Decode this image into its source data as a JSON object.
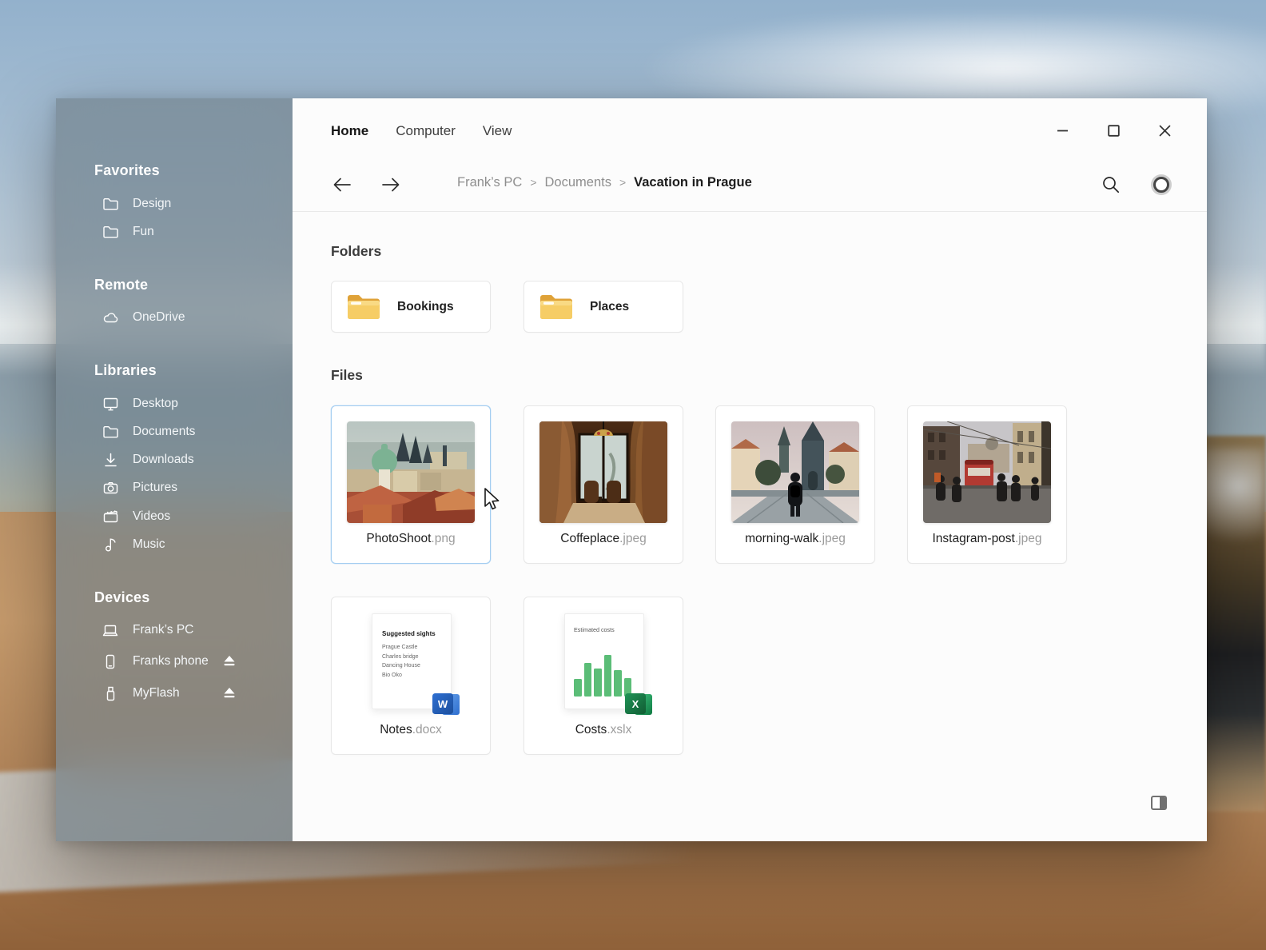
{
  "window": {
    "tabs": [
      "Home",
      "Computer",
      "View"
    ],
    "active_tab": "Home"
  },
  "toolbar": {
    "breadcrumb": [
      "Frank’s PC",
      "Documents",
      "Vacation in Prague"
    ],
    "separator": ">"
  },
  "sidebar": {
    "sections": [
      {
        "title": "Favorites",
        "items": [
          {
            "label": "Design",
            "icon": "folder-icon"
          },
          {
            "label": "Fun",
            "icon": "folder-icon"
          }
        ]
      },
      {
        "title": "Remote",
        "items": [
          {
            "label": "OneDrive",
            "icon": "cloud-icon"
          }
        ]
      },
      {
        "title": "Libraries",
        "items": [
          {
            "label": "Desktop",
            "icon": "monitor-icon"
          },
          {
            "label": "Documents",
            "icon": "folder-icon"
          },
          {
            "label": "Downloads",
            "icon": "download-icon"
          },
          {
            "label": "Pictures",
            "icon": "camera-icon"
          },
          {
            "label": "Videos",
            "icon": "clapperboard-icon"
          },
          {
            "label": "Music",
            "icon": "music-note-icon"
          }
        ]
      },
      {
        "title": "Devices",
        "items": [
          {
            "label": "Frank’s PC",
            "icon": "laptop-icon"
          },
          {
            "label": "Franks phone",
            "icon": "phone-icon",
            "ejectable": true
          },
          {
            "label": "MyFlash",
            "icon": "usb-icon",
            "ejectable": true
          }
        ]
      }
    ]
  },
  "content": {
    "folders": {
      "heading": "Folders",
      "items": [
        {
          "name": "Bookings"
        },
        {
          "name": "Places"
        }
      ]
    },
    "files": {
      "heading": "Files",
      "images": [
        {
          "base": "PhotoShoot",
          "ext": ".png",
          "selected": true,
          "thumbnail": "prague-rooftops"
        },
        {
          "base": "Coffeplace",
          "ext": ".jpeg",
          "selected": false,
          "thumbnail": "cafe-interior"
        },
        {
          "base": "morning-walk",
          "ext": ".jpeg",
          "selected": false,
          "thumbnail": "charles-bridge-walk"
        },
        {
          "base": "Instagram-post",
          "ext": ".jpeg",
          "selected": false,
          "thumbnail": "street-with-tram"
        }
      ],
      "documents": [
        {
          "base": "Notes",
          "ext": ".docx",
          "app": "word",
          "badge": "W",
          "preview": {
            "title": "Suggested sights",
            "lines": [
              "Prague Castle",
              "Charles bridge",
              "Dancing House",
              "Bio Oko"
            ]
          }
        },
        {
          "base": "Costs",
          "ext": ".xslx",
          "app": "excel",
          "badge": "X",
          "preview": {
            "title": "Estimated costs",
            "chart_bars": [
              0.42,
              0.8,
              0.67,
              1.0,
              0.63,
              0.45
            ]
          }
        }
      ]
    }
  },
  "colors": {
    "selection_border": "#a3cdf1",
    "folder_yellow": "#f2c14e",
    "word_blue": "#2e6fd2",
    "excel_green": "#1f9457",
    "preview_bar_green": "#5bbd77",
    "sidebar_acrylic": "rgba(116,131,142,0.72)"
  }
}
